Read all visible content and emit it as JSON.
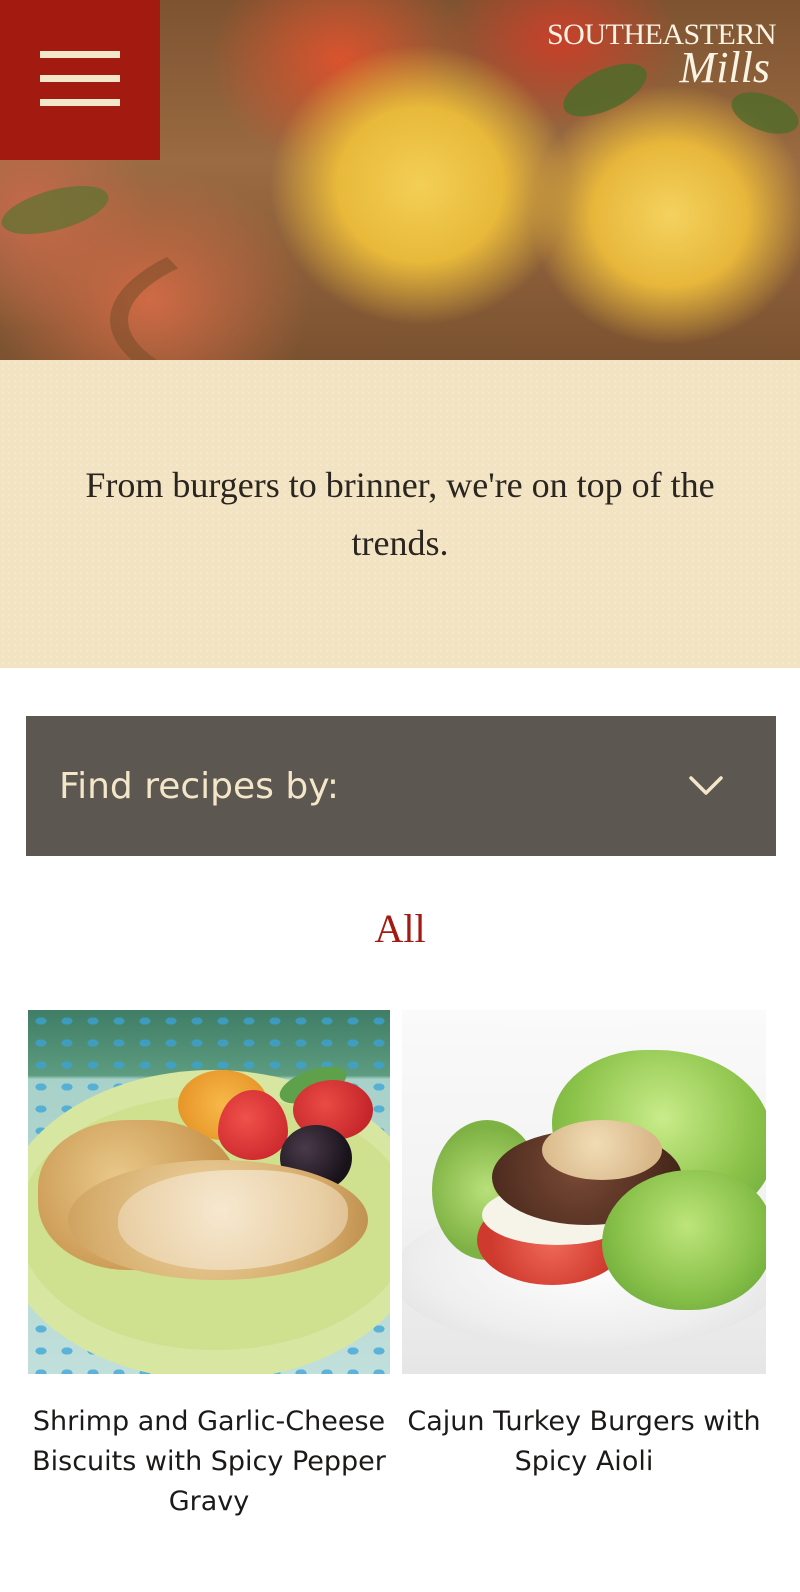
{
  "header": {
    "menu_icon": "hamburger-menu-icon",
    "logo": {
      "line1": "SOUTHEASTERN",
      "line2": "Mills"
    },
    "hero_image": "fruit-bowl-photo"
  },
  "tagline": "From burgers to brinner, we're on top of the trends.",
  "filter": {
    "label": "Find recipes by:",
    "icon": "chevron-down-icon"
  },
  "category": "All",
  "recipes": [
    {
      "title": "Shrimp and Garlic-Cheese Biscuits with Spicy Pepper Gravy",
      "image": "biscuits-and-gravy-photo"
    },
    {
      "title": "Cajun Turkey Burgers with Spicy Aioli",
      "image": "turkey-burger-lettuce-wrap-photo"
    }
  ],
  "colors": {
    "brand_red": "#a31b10",
    "cream": "#f2e4c3",
    "filter_bg": "#5d5752",
    "filter_text": "#f4e6c8"
  }
}
